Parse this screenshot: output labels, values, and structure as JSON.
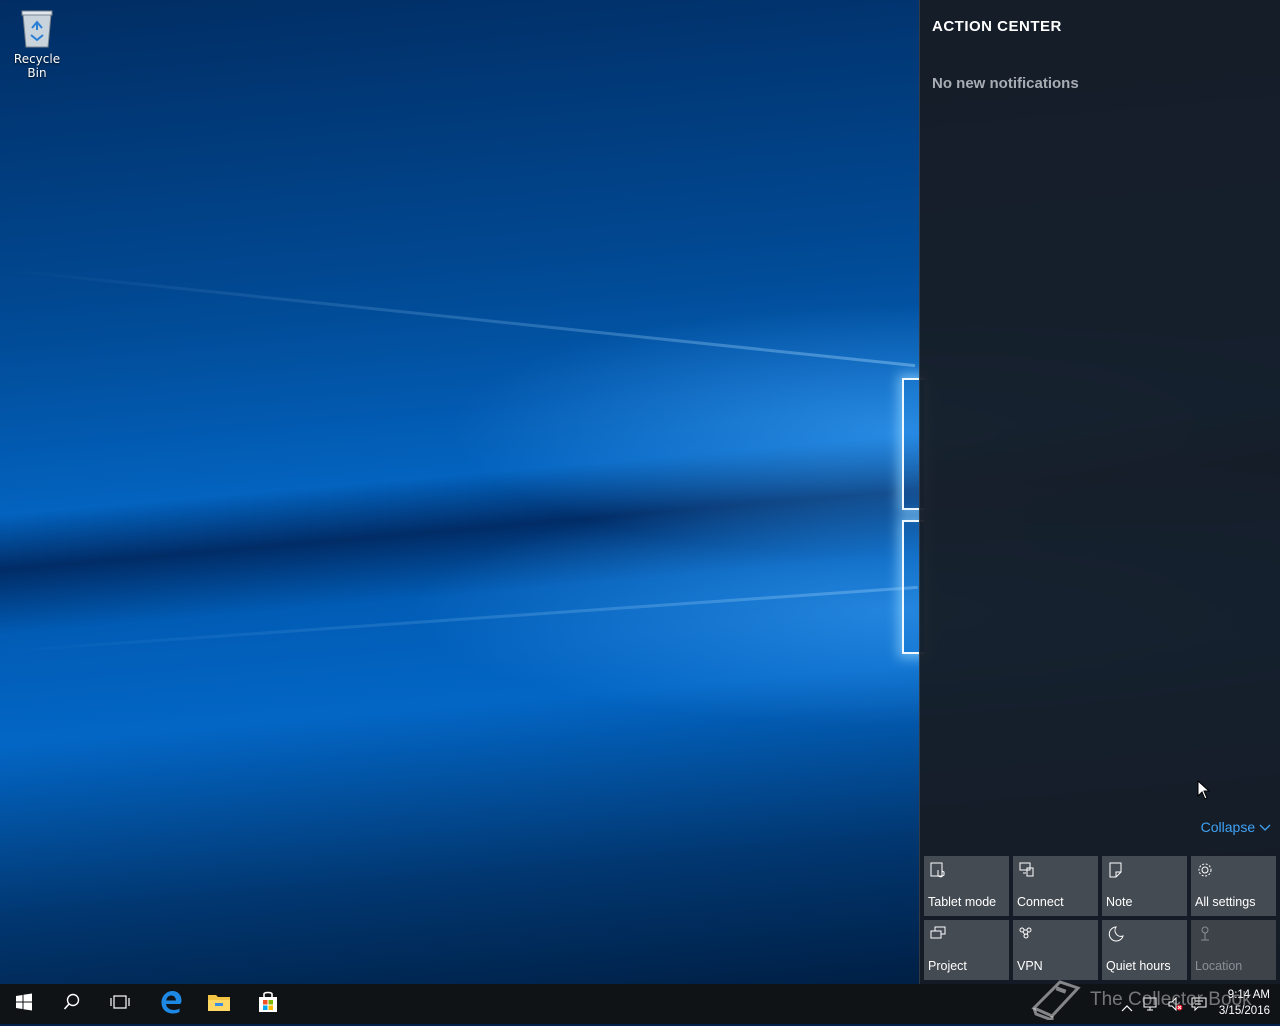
{
  "desktop": {
    "icons": [
      {
        "label": "Recycle Bin",
        "icon": "recycle-bin-icon"
      }
    ]
  },
  "action_center": {
    "title": "ACTION CENTER",
    "empty_message": "No new notifications",
    "collapse_label": "Collapse",
    "accent_color": "#3fa3f5",
    "quick_actions": [
      {
        "label": "Tablet mode",
        "icon": "tablet-mode-icon",
        "enabled": true
      },
      {
        "label": "Connect",
        "icon": "connect-icon",
        "enabled": true
      },
      {
        "label": "Note",
        "icon": "note-icon",
        "enabled": true
      },
      {
        "label": "All settings",
        "icon": "gear-icon",
        "enabled": true
      },
      {
        "label": "Project",
        "icon": "project-icon",
        "enabled": true
      },
      {
        "label": "VPN",
        "icon": "vpn-icon",
        "enabled": true
      },
      {
        "label": "Quiet hours",
        "icon": "moon-icon",
        "enabled": true
      },
      {
        "label": "Location",
        "icon": "location-icon",
        "enabled": false
      }
    ]
  },
  "taskbar": {
    "buttons": [
      "start-icon",
      "search-icon",
      "task-view-icon",
      "edge-icon",
      "file-explorer-icon",
      "store-icon"
    ],
    "tray_icons": [
      "chevron-up-icon",
      "network-icon",
      "volume-muted-icon",
      "notification-icon"
    ],
    "time": "9:14 AM",
    "date": "3/15/2016"
  },
  "watermark": {
    "text": "The Collector Book"
  }
}
